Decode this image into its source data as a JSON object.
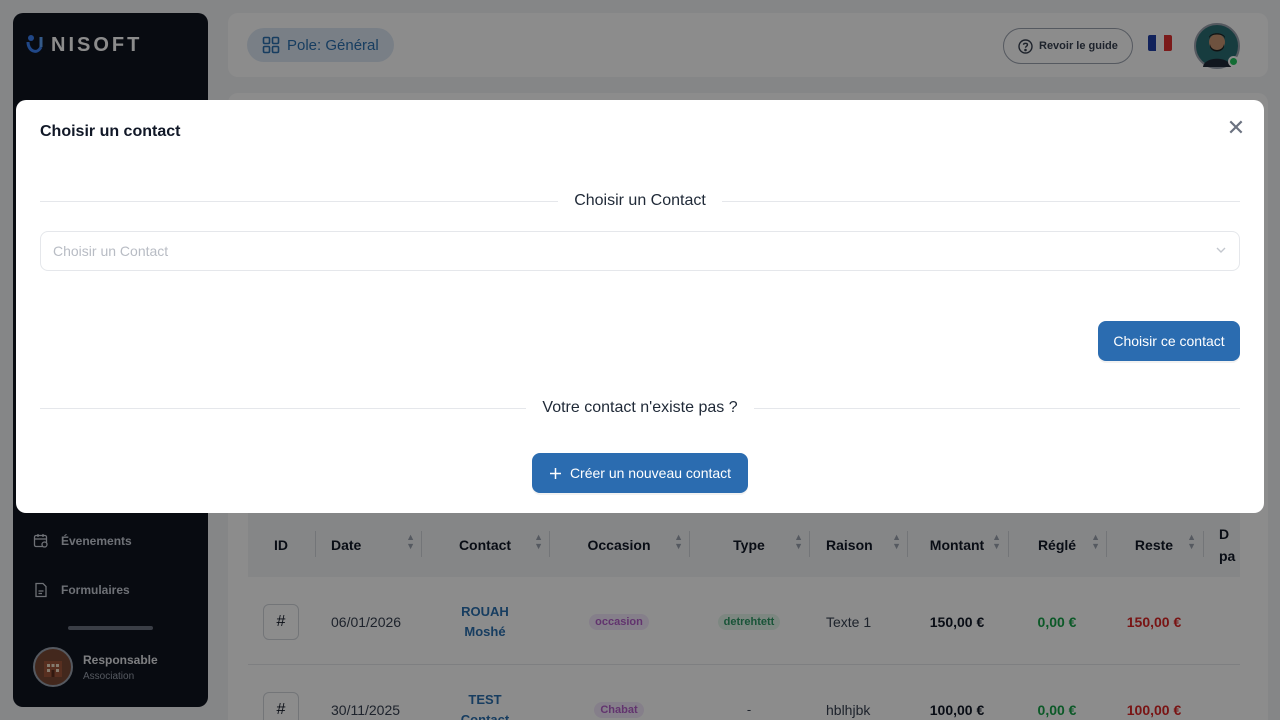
{
  "sidebar": {
    "logo_text": "NISOFT",
    "items": [
      {
        "label": "Évenements",
        "icon": "calendar-icon"
      },
      {
        "label": "Formulaires",
        "icon": "form-icon"
      }
    ],
    "user": {
      "name": "Responsable",
      "role": "Association"
    }
  },
  "topbar": {
    "pole_label": "Pole: Général",
    "guide_label": "Revoir le guide",
    "language": "fr"
  },
  "table": {
    "headers": [
      "ID",
      "Date",
      "Contact",
      "Occasion",
      "Type",
      "Raison",
      "Montant",
      "Réglé",
      "Reste",
      "D pa"
    ],
    "rows": [
      {
        "id": "#",
        "date": "06/01/2026",
        "contact_first": "ROUAH",
        "contact_second": "Moshé",
        "occasion": "occasion",
        "type": "detrehtett",
        "raison": "Texte 1",
        "montant": "150,00 €",
        "regle": "0,00 €",
        "reste": "150,00 €"
      },
      {
        "id": "#",
        "date": "30/11/2025",
        "contact_first": "TEST",
        "contact_second": "Contact",
        "occasion": "Chabat",
        "type": "-",
        "raison": "hblhjbk",
        "montant": "100,00 €",
        "regle": "0,00 €",
        "reste": "100,00 €"
      }
    ]
  },
  "modal": {
    "title": "Choisir un contact",
    "section_label": "Choisir un Contact",
    "select_placeholder": "Choisir un Contact",
    "choose_button": "Choisir ce contact",
    "not_exist_label": "Votre contact n'existe pas ?",
    "create_button": "Créer un nouveau contact"
  },
  "colors": {
    "primary": "#2b6cb0",
    "sidebar_bg": "#0f1420",
    "success": "#16a34a",
    "danger": "#dc2626"
  }
}
